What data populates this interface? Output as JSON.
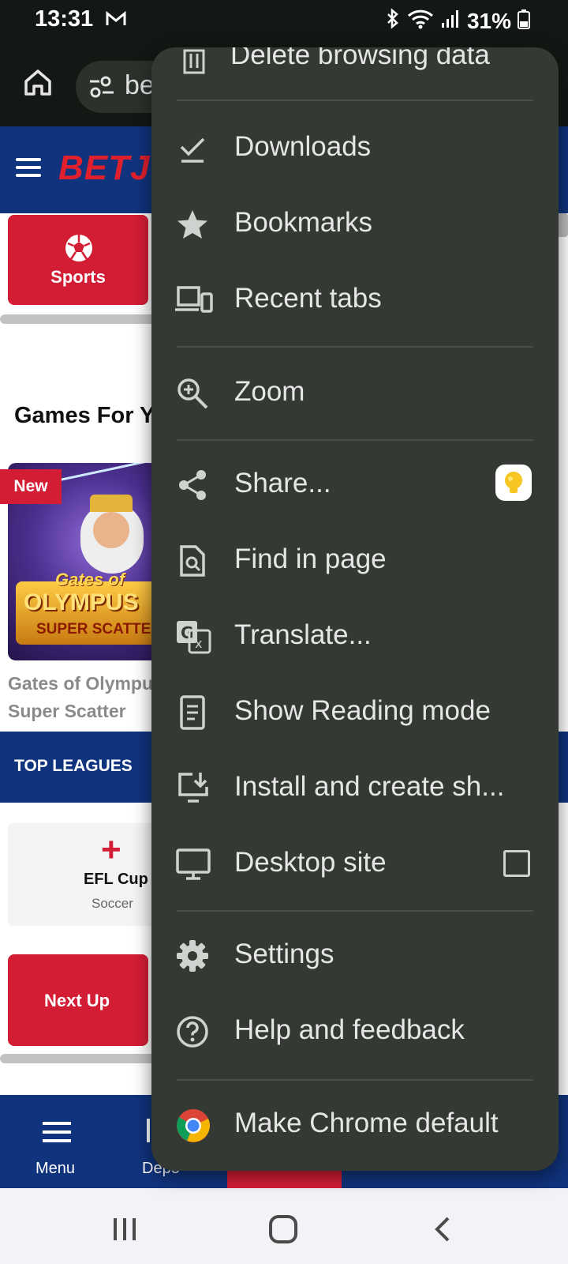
{
  "status_bar": {
    "time": "13:31",
    "battery": "31%",
    "icons": [
      "gmail-icon",
      "bluetooth-icon",
      "wifi-icon",
      "signal-icon",
      "battery-icon"
    ]
  },
  "browser": {
    "url_partial": "be"
  },
  "site": {
    "brand_partial": "BETJ",
    "sports_tile_label": "Sports",
    "games_heading_partial": "Games For Y",
    "game_new_badge": "New",
    "game_art": {
      "line1": "Gates of",
      "line2": "OLYMPUS",
      "line3": "SUPER SCATTE"
    },
    "game_title_line1": "Gates of Olympu",
    "game_title_line2": "Super Scatter",
    "top_leagues_label": "TOP LEAGUES",
    "league": {
      "name": "EFL Cup",
      "sport": "Soccer"
    },
    "next_up_label": "Next Up",
    "bottom_nav": {
      "menu_label": "Menu",
      "deposit_label_partial": "Depo"
    },
    "colors": {
      "brand_blue": "#10337d",
      "brand_red": "#d31d35"
    }
  },
  "menu": {
    "background": "#343a33",
    "items": [
      {
        "label": "Delete browsing data",
        "icon": "trash-icon"
      },
      {
        "label": "Downloads",
        "icon": "download-check-icon"
      },
      {
        "label": "Bookmarks",
        "icon": "star-icon"
      },
      {
        "label": "Recent tabs",
        "icon": "devices-icon"
      },
      {
        "label": "Zoom",
        "icon": "zoom-in-icon"
      },
      {
        "label": "Share...",
        "icon": "share-icon"
      },
      {
        "label": "Find in page",
        "icon": "find-in-page-icon"
      },
      {
        "label": "Translate...",
        "icon": "translate-icon"
      },
      {
        "label": "Show Reading mode",
        "icon": "reading-mode-icon"
      },
      {
        "label": "Install and create sh...",
        "icon": "install-icon"
      },
      {
        "label": "Desktop site",
        "icon": "desktop-icon"
      },
      {
        "label": "Settings",
        "icon": "gear-icon"
      },
      {
        "label": "Help and feedback",
        "icon": "help-icon"
      },
      {
        "label": "Make Chrome default",
        "icon": "chrome-icon"
      }
    ],
    "desktop_site_checked": false
  }
}
